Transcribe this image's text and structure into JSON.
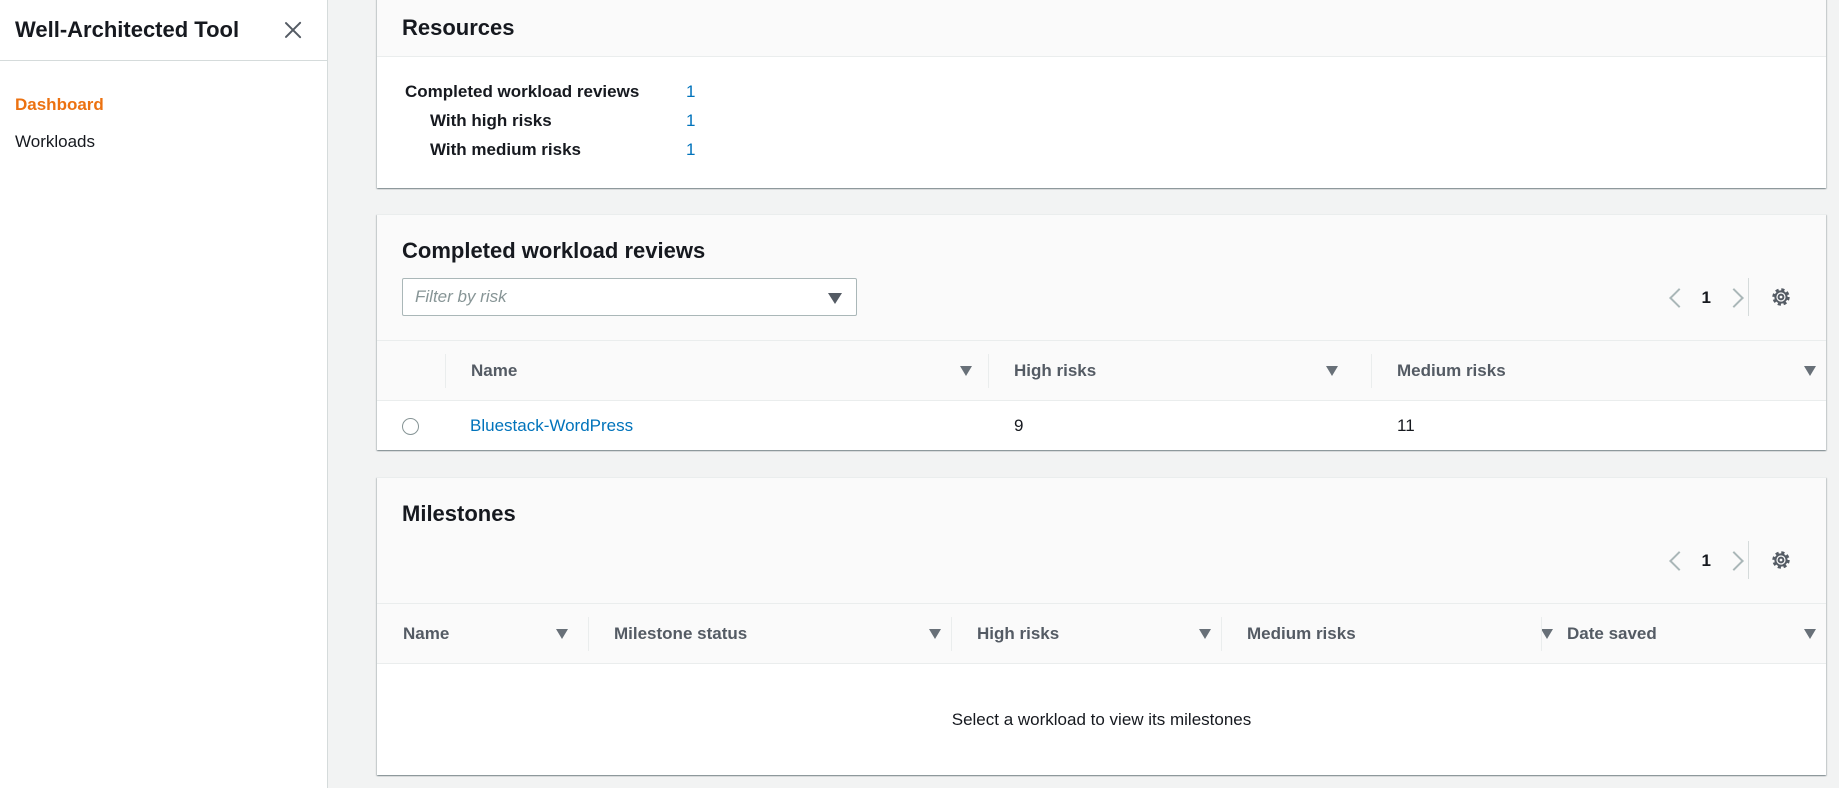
{
  "sidebar": {
    "title": "Well-Architected Tool",
    "close_icon": "close-icon",
    "items": [
      {
        "label": "Dashboard",
        "active": true
      },
      {
        "label": "Workloads",
        "active": false
      }
    ]
  },
  "resources": {
    "title": "Resources",
    "rows": [
      {
        "label": "Completed workload reviews",
        "value": "1"
      },
      {
        "label": "With high risks",
        "value": "1"
      },
      {
        "label": "With medium risks",
        "value": "1"
      }
    ]
  },
  "reviews": {
    "title": "Completed workload reviews",
    "filter_placeholder": "Filter by risk",
    "page": "1",
    "columns": [
      "Name",
      "High risks",
      "Medium risks"
    ],
    "rows": [
      {
        "name": "Bluestack-WordPress",
        "high": "9",
        "medium": "11"
      }
    ]
  },
  "milestones": {
    "title": "Milestones",
    "page": "1",
    "columns": [
      "Name",
      "Milestone status",
      "High risks",
      "Medium risks",
      "Date saved"
    ],
    "empty_text": "Select a workload to view its milestones"
  },
  "colors": {
    "accent": "#ec7211",
    "link": "#0073bb",
    "background": "#f2f3f3"
  }
}
